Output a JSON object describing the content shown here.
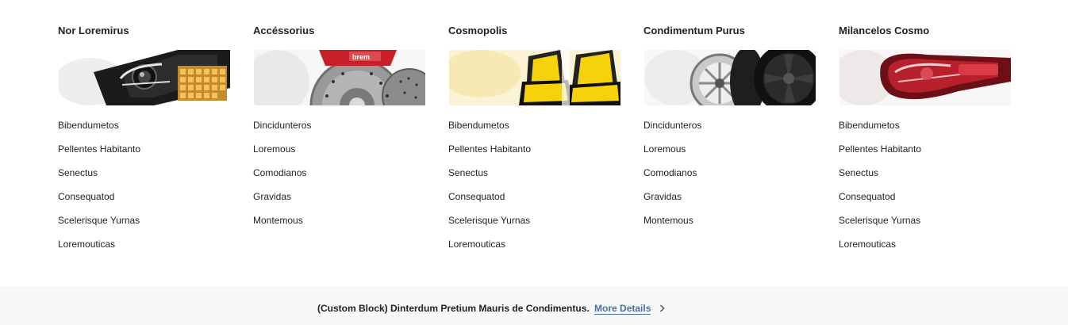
{
  "columns": [
    {
      "title": "Nor Loremirus",
      "image": "headlight-image",
      "links": [
        "Bibendumetos",
        "Pellentes Habitanto",
        "Senectus",
        "Consequatod",
        "Scelerisque Yurnas",
        "Loremouticas"
      ]
    },
    {
      "title": "Accéssorius",
      "image": "brake-rotor-image",
      "brand_text": "brem",
      "links": [
        "Dincidunteros",
        "Loremous",
        "Comodianos",
        "Gravidas",
        "Montemous"
      ]
    },
    {
      "title": "Cosmopolis",
      "image": "racing-seats-image",
      "links": [
        "Bibendumetos",
        "Pellentes Habitanto",
        "Senectus",
        "Consequatod",
        "Scelerisque Yurnas",
        "Loremouticas"
      ]
    },
    {
      "title": "Condimentum Purus",
      "image": "wheels-image",
      "links": [
        "Dincidunteros",
        "Loremous",
        "Comodianos",
        "Gravidas",
        "Montemous"
      ]
    },
    {
      "title": "Milancelos Cosmo",
      "image": "tail-light-image",
      "links": [
        "Bibendumetos",
        "Pellentes Habitanto",
        "Senectus",
        "Consequatod",
        "Scelerisque Yurnas",
        "Loremouticas"
      ]
    }
  ],
  "footer": {
    "text": "(Custom Block) Dinterdum Pretium Mauris de Condimentus.",
    "link_label": "More Details",
    "icon": "chevron-right-icon"
  },
  "colors": {
    "link": "#4a6fa5",
    "footer_bg": "#f7f7f7",
    "brake_red": "#c8202a",
    "seat_yellow": "#f5d20a"
  }
}
